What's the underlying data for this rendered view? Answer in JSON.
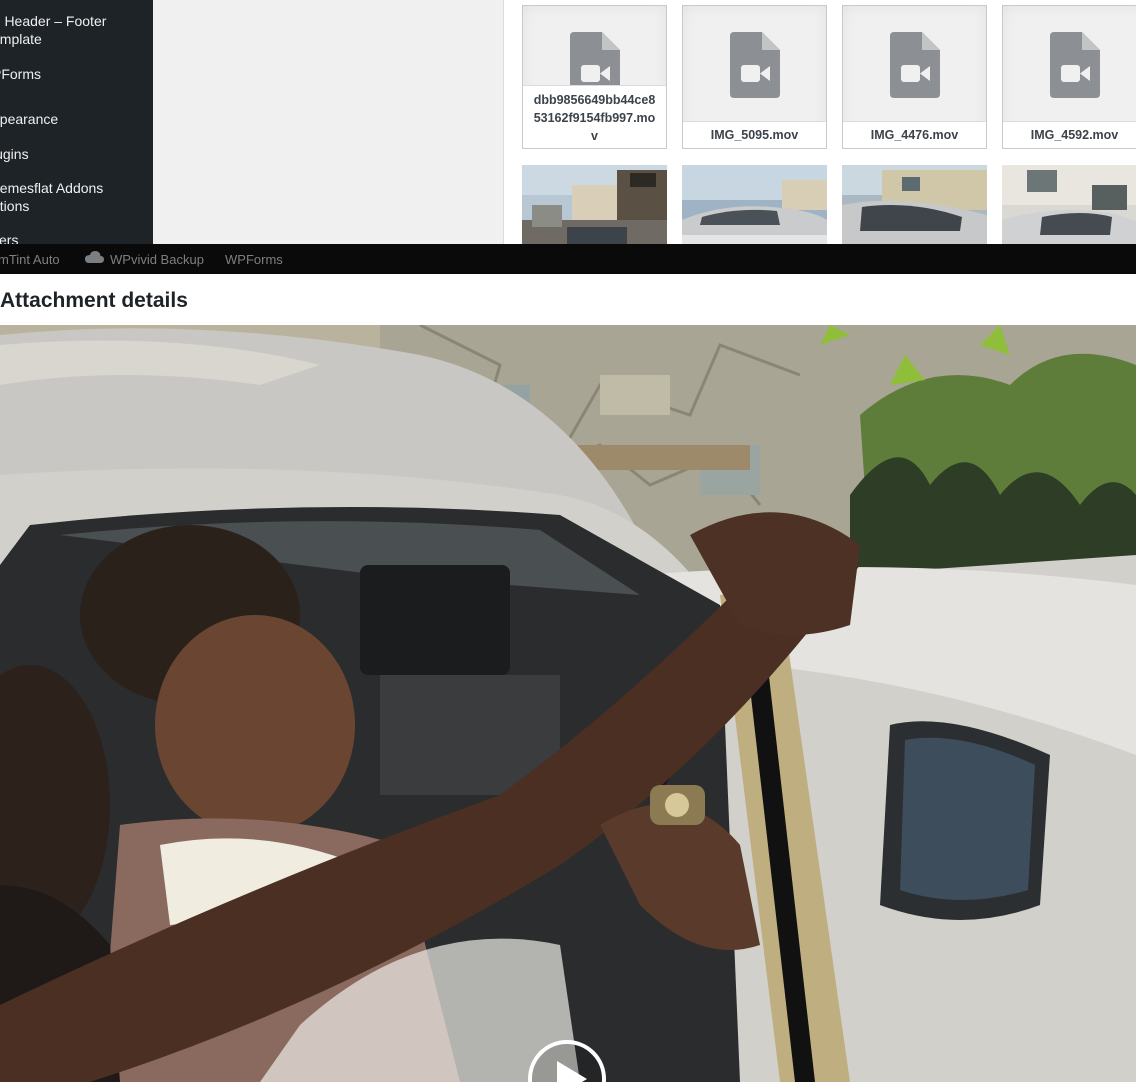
{
  "sidebar": {
    "items": [
      {
        "label": "F Header – Footer\nemplate"
      },
      {
        "label": "PForms"
      },
      {
        "label": "ppearance"
      },
      {
        "label": "lugins"
      },
      {
        "label": "hemesflat Addons\nptions"
      },
      {
        "label": "sers"
      }
    ]
  },
  "media_grid": {
    "files": [
      {
        "name": "dbb9856649bb44ce853162f9154fb997.mov",
        "icon": "video-file-icon"
      },
      {
        "name": "IMG_5095.mov",
        "icon": "video-file-icon"
      },
      {
        "name": "IMG_4476.mov",
        "icon": "video-file-icon"
      },
      {
        "name": "IMG_4592.mov",
        "icon": "video-file-icon"
      }
    ],
    "thumbnails": [
      {
        "description": "street-thumbnail"
      },
      {
        "description": "car-thumbnail"
      },
      {
        "description": "car-side-thumbnail"
      },
      {
        "description": "building-thumbnail"
      }
    ]
  },
  "adminbar": {
    "items": [
      {
        "label": "mTint Auto"
      },
      {
        "label": "WPvivid Backup",
        "icon": "cloud-icon"
      },
      {
        "label": "WPForms"
      }
    ]
  },
  "modal": {
    "title": "Attachment details",
    "video": {
      "control": "play-icon"
    }
  },
  "colors": {
    "sidebar_bg": "#1d2327",
    "adminbar_bg": "#0a0a0a",
    "tile_bg": "#f0f0f1",
    "icon_gray": "#8c8f94"
  }
}
